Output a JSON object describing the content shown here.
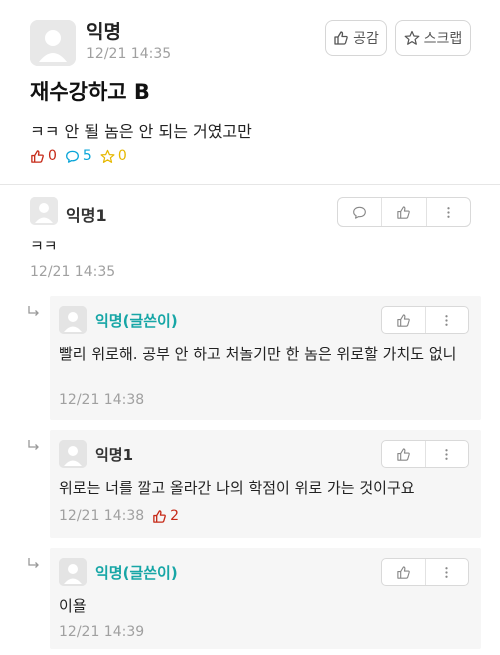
{
  "post": {
    "author": "익명",
    "time": "12/21 14:35",
    "like_button": "공감",
    "scrap_button": "스크랩",
    "title": "재수강하고 B",
    "body": "ㅋㅋ 안 될 놈은 안 되는 거였고만",
    "stats": {
      "likes": "0",
      "comments": "5",
      "scraps": "0"
    }
  },
  "comment": {
    "author": "익명1",
    "text": "ㅋㅋ",
    "time": "12/21 14:35"
  },
  "replies": [
    {
      "author": "익명(글쓴이)",
      "is_op": true,
      "text": "빨리 위로해. 공부 안 하고 처놀기만 한 놈은 위로할 가치도 없니",
      "time": "12/21 14:38",
      "likes": ""
    },
    {
      "author": "익명1",
      "is_op": false,
      "text": "위로는 너를 깔고 올라간 나의 학점이 위로 가는 것이구요",
      "time": "12/21 14:38",
      "likes": "2"
    },
    {
      "author": "익명(글쓴이)",
      "is_op": true,
      "text": "이욜",
      "time": "12/21 14:39",
      "likes": ""
    }
  ],
  "colors": {
    "like_red": "#c62917",
    "comment_blue": "#0aa5d8",
    "scrap_yellow": "#e6b800",
    "op_teal": "#17a6a6"
  },
  "icons": [
    "thumbs-up-icon",
    "star-icon",
    "speech-bubble-icon",
    "more-vertical-icon",
    "reply-arrow-icon",
    "avatar-placeholder-icon"
  ]
}
